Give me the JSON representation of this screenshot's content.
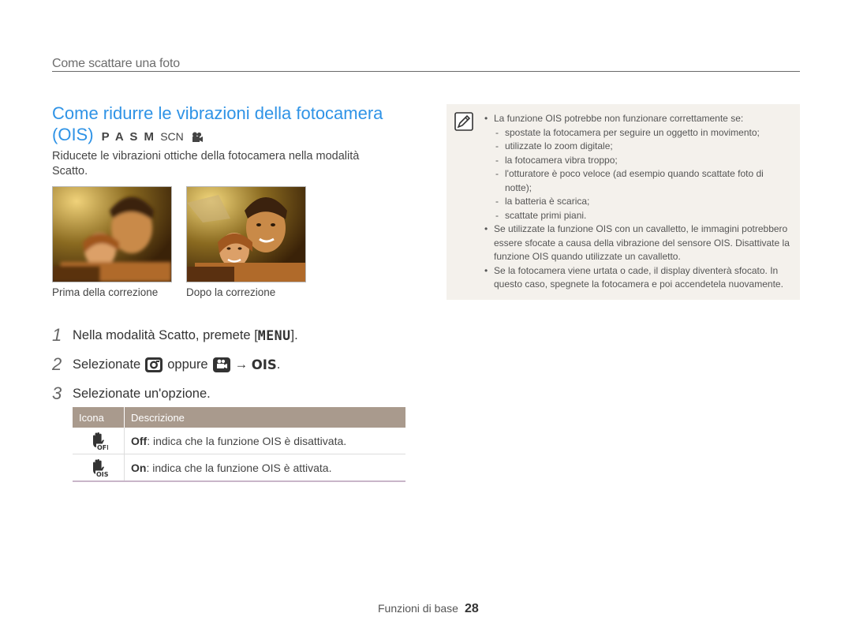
{
  "section_title": "Come scattare una foto",
  "heading": {
    "line1": "Come ridurre le vibrazioni della fotocamera",
    "line2": "(OIS)",
    "modes": "P A S M",
    "scn": "SCN"
  },
  "intro": "Riducete le vibrazioni ottiche della fotocamera nella modalità Scatto.",
  "images": {
    "before_caption": "Prima della correzione",
    "after_caption": "Dopo la correzione"
  },
  "steps": [
    {
      "num": "1",
      "text": "Nella modalità Scatto, premete [",
      "key": "MENU",
      "after": "]."
    },
    {
      "num": "2",
      "pre": "Selezionate",
      "mid": "oppure",
      "arrow": "→",
      "key": "OIS",
      "after": "."
    },
    {
      "num": "3",
      "text": "Selezionate un'opzione."
    }
  ],
  "table": {
    "header": {
      "icon": "Icona",
      "desc": "Descrizione"
    },
    "rows": [
      {
        "icon": "ois-off-icon",
        "label": "Off",
        "text": ": indica che la funzione OIS è disattivata."
      },
      {
        "icon": "ois-on-icon",
        "label": "On",
        "text": ": indica che la funzione OIS è attivata."
      }
    ]
  },
  "note": {
    "icon": "note-pencil-icon",
    "items": [
      {
        "type": "b",
        "text": "La funzione OIS potrebbe non funzionare correttamente se:"
      },
      {
        "type": "d",
        "text": "spostate la fotocamera per seguire un oggetto in movimento;"
      },
      {
        "type": "d",
        "text": "utilizzate lo zoom digitale;"
      },
      {
        "type": "d",
        "text": "la fotocamera vibra troppo;"
      },
      {
        "type": "d",
        "text": "l'otturatore è poco veloce (ad esempio quando scattate foto di notte);"
      },
      {
        "type": "d",
        "text": "la batteria è scarica;"
      },
      {
        "type": "d",
        "text": "scattate primi piani."
      },
      {
        "type": "b",
        "text": "Se utilizzate la funzione OIS con un cavalletto, le immagini potrebbero essere sfocate a causa della vibrazione del sensore OIS. Disattivate la funzione OIS quando utilizzate un cavalletto."
      },
      {
        "type": "b",
        "text": "Se la fotocamera viene urtata o cade, il display diventerà sfocato. In questo caso, spegnete la fotocamera e poi accendetela nuovamente."
      }
    ]
  },
  "footer": {
    "label": "Funzioni di base",
    "page": "28"
  }
}
